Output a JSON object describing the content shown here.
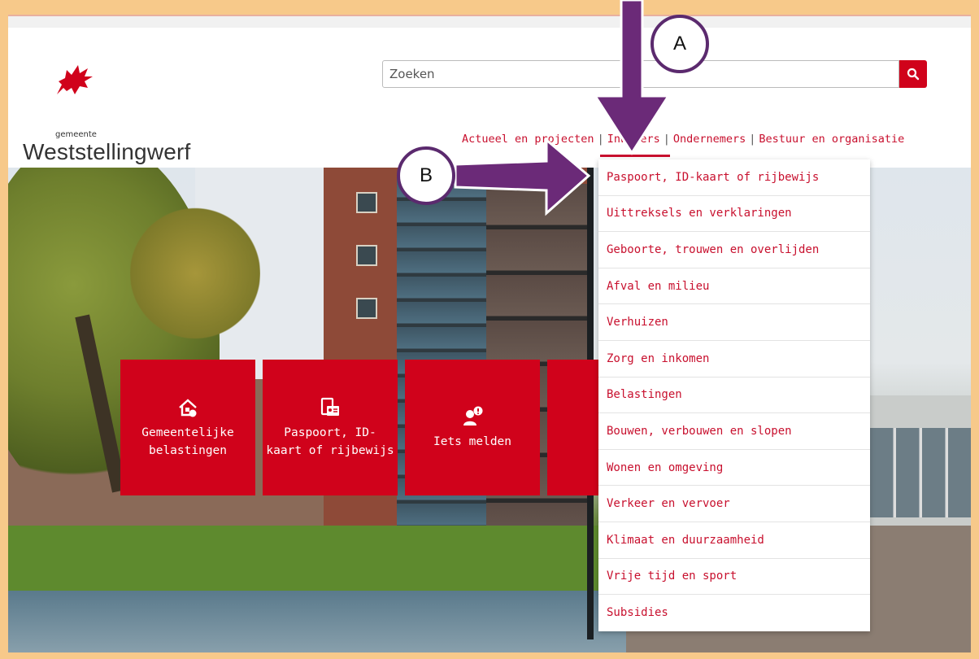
{
  "logo": {
    "subtitle": "gemeente",
    "name": "Weststellingwerf",
    "icon": "griffin-icon"
  },
  "search": {
    "placeholder": "Zoeken",
    "value": "",
    "icon": "search-icon"
  },
  "nav": {
    "items": [
      "Actueel en projecten",
      "Inwoners",
      "Ondernemers",
      "Bestuur en organisatie"
    ],
    "separator": "|",
    "active": "Inwoners"
  },
  "dropdown": {
    "items": [
      "Paspoort, ID-kaart of rijbewijs",
      "Uittreksels en verklaringen",
      "Geboorte, trouwen en overlijden",
      "Afval en milieu",
      "Verhuizen",
      "Zorg en inkomen",
      "Belastingen",
      "Bouwen, verbouwen en slopen",
      "Wonen en omgeving",
      "Verkeer en vervoer",
      "Klimaat en duurzaamheid",
      "Vrije tijd en sport",
      "Subsidies"
    ]
  },
  "tiles": [
    {
      "line1": "Gemeentelijke",
      "line2": "belastingen",
      "icon": "house-coin-icon"
    },
    {
      "line1": "Paspoort, ID-",
      "line2": "kaart of rijbewijs",
      "icon": "id-card-icon"
    },
    {
      "line1": "Iets melden",
      "line2": "",
      "icon": "report-icon"
    }
  ],
  "annotations": {
    "a": "A",
    "b": "B"
  },
  "colors": {
    "brand": "#d0021b",
    "link": "#c8102e",
    "annotation": "#5b2a6e",
    "frame": "#f7c98a"
  }
}
